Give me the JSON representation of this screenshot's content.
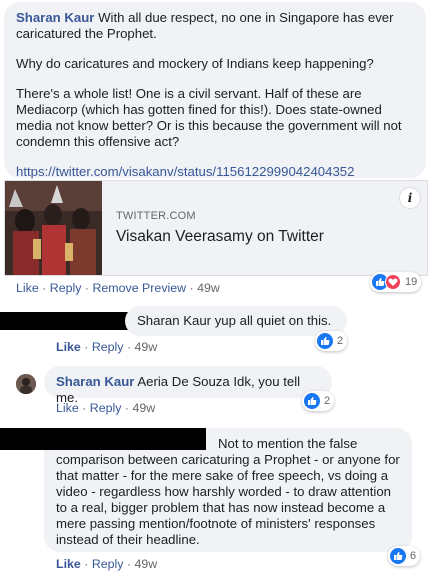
{
  "comment1": {
    "author": "Sharan Kaur",
    "text_line1": " With all due respect, no one in Singapore has ever",
    "text_line2": "caricatured the Prophet.",
    "para2": "Why do caricatures and mockery of Indians keep happening?",
    "para3": "There's a whole list! One is a civil servant. Half of these are Mediacorp (which has gotten fined for this!). Does state-owned media not know better? Or is this because the government will not condemn this offensive act?",
    "link": "https://twitter.com/visakanv/status/1156122999042404352",
    "preview": {
      "domain": "TWITTER.COM",
      "title": "Visakan Veerasamy on Twitter",
      "info_glyph": "i"
    },
    "reactions_count": "19",
    "actions": {
      "like": "Like",
      "reply": "Reply",
      "remove_preview": "Remove Preview",
      "time": "49w"
    }
  },
  "reply1": {
    "text": "Sharan Kaur yup all quiet on this.",
    "reactions_count": "2",
    "actions": {
      "like": "Like",
      "reply": "Reply",
      "time": "49w"
    }
  },
  "reply2": {
    "author": "Sharan Kaur",
    "text": " Aeria De Souza Idk, you tell me.",
    "reactions_count": "2",
    "actions": {
      "like": "Like",
      "reply": "Reply",
      "time": "49w"
    }
  },
  "reply3": {
    "text_first": "Not to mention the false",
    "text_rest": "comparison between caricaturing a Prophet - or anyone for that matter - for the mere sake of free speech, vs doing a video - regardless how harshly worded - to draw attention to a real, bigger problem that has now instead become a mere passing mention/footnote of ministers' responses instead of their headline.",
    "reactions_count": "6",
    "actions": {
      "like": "Like",
      "reply": "Reply",
      "time": "49w"
    }
  },
  "separator": " · ",
  "colors": {
    "link": "#385898",
    "bubble": "#f0f2f5",
    "like": "#1877f2",
    "love": "#f33e58"
  },
  "icons": {
    "like": "thumbs-up-icon",
    "love": "heart-icon",
    "info": "info-icon"
  }
}
